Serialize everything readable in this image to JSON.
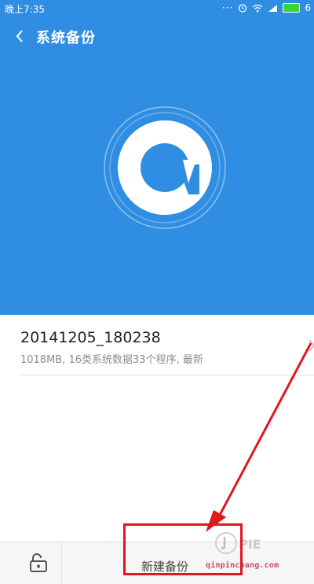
{
  "status_bar": {
    "time": "晚上7:35",
    "battery_label": "6"
  },
  "header": {
    "title": "系统备份"
  },
  "backup_item": {
    "name": "20141205_180238",
    "details": "1018MB, 16类系统数据33个程序, 最新"
  },
  "bottom_bar": {
    "new_backup_label": "新建备份"
  },
  "watermark": {
    "domain": "qinpinchang.com"
  },
  "colors": {
    "accent": "#2f8ee2",
    "annotation_red": "#e0171f"
  }
}
